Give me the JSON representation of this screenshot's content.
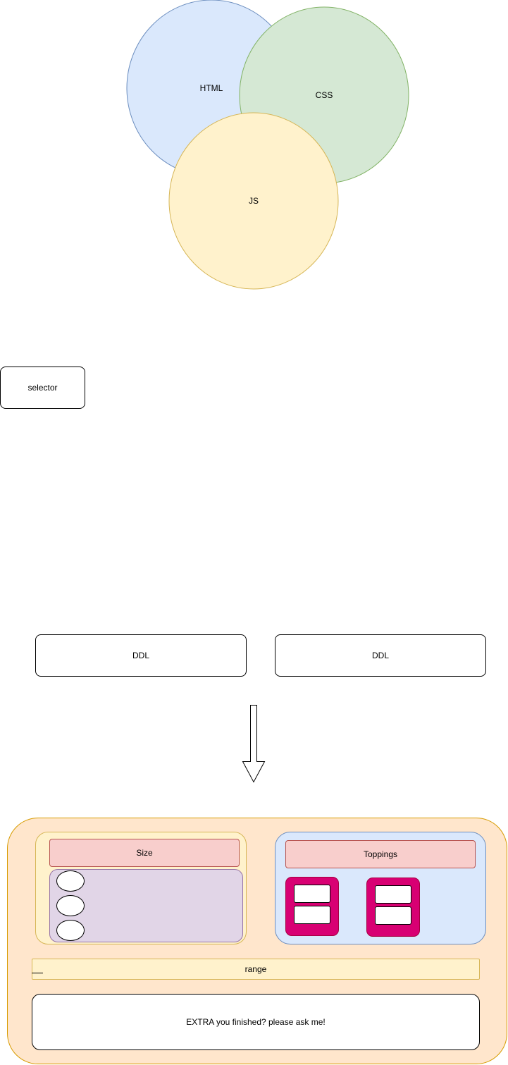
{
  "venn": {
    "html_label": "HTML",
    "css_label": "CSS",
    "js_label": "JS",
    "colors": {
      "html_fill": "#dae8fc",
      "html_stroke": "#6c8ebf",
      "css_fill": "#d5e8d4",
      "css_stroke": "#82b366",
      "js_fill": "#fff2cc",
      "js_stroke": "#d6b656"
    }
  },
  "selector": {
    "label": "selector"
  },
  "ddl": {
    "left_label": "DDL",
    "right_label": "DDL"
  },
  "arrow": {
    "icon": "down-arrow-icon"
  },
  "form": {
    "size_label": "Size",
    "toppings_label": "Toppings",
    "range_label": "range",
    "extra_label": "EXTRA you finished? please ask me!"
  }
}
